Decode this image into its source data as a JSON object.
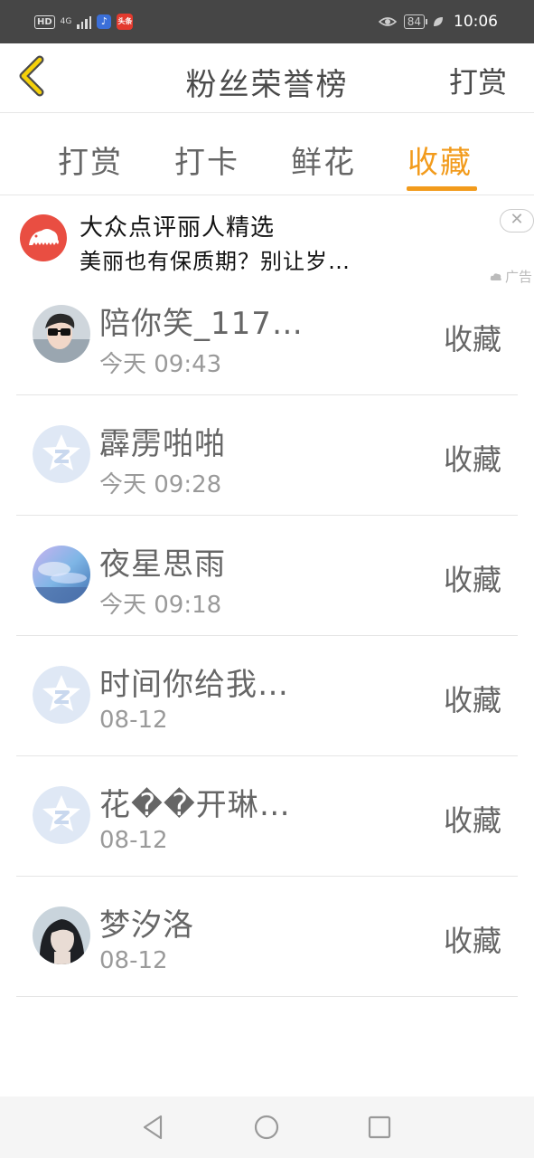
{
  "status_bar": {
    "hd_label": "HD",
    "network_label": "4G",
    "app_badge_2": "头条",
    "battery": "84",
    "time": "10:06"
  },
  "header": {
    "title": "粉丝荣誉榜",
    "action_label": "打赏"
  },
  "tabs": [
    {
      "label": "打赏",
      "active": false
    },
    {
      "label": "打卡",
      "active": false
    },
    {
      "label": "鲜花",
      "active": false
    },
    {
      "label": "收藏",
      "active": true
    }
  ],
  "ad": {
    "title": "大众点评丽人精选",
    "description": "美丽也有保质期？别让岁…",
    "tag": "广告"
  },
  "list": [
    {
      "name": "陪你笑_117…",
      "time": "今天 09:43",
      "action": "收藏",
      "avatar": "photo-boy-glasses"
    },
    {
      "name": "霹雳啪啪",
      "time": "今天 09:28",
      "action": "收藏",
      "avatar": "default-z-star"
    },
    {
      "name": "夜星思雨",
      "time": "今天 09:18",
      "action": "收藏",
      "avatar": "photo-sky"
    },
    {
      "name": "时间你给我…",
      "time": "08-12",
      "action": "收藏",
      "avatar": "default-z-star"
    },
    {
      "name": "花��开琳…",
      "time": "08-12",
      "action": "收藏",
      "avatar": "default-z-star"
    },
    {
      "name": "梦汐洛",
      "time": "08-12",
      "action": "收藏",
      "avatar": "photo-girl"
    }
  ],
  "colors": {
    "accent": "#f29b1c",
    "status_bar": "#464646",
    "divider": "#e5e5e5",
    "default_avatar_bg": "#dfe8f5",
    "ad_logo": "#e94e42"
  }
}
